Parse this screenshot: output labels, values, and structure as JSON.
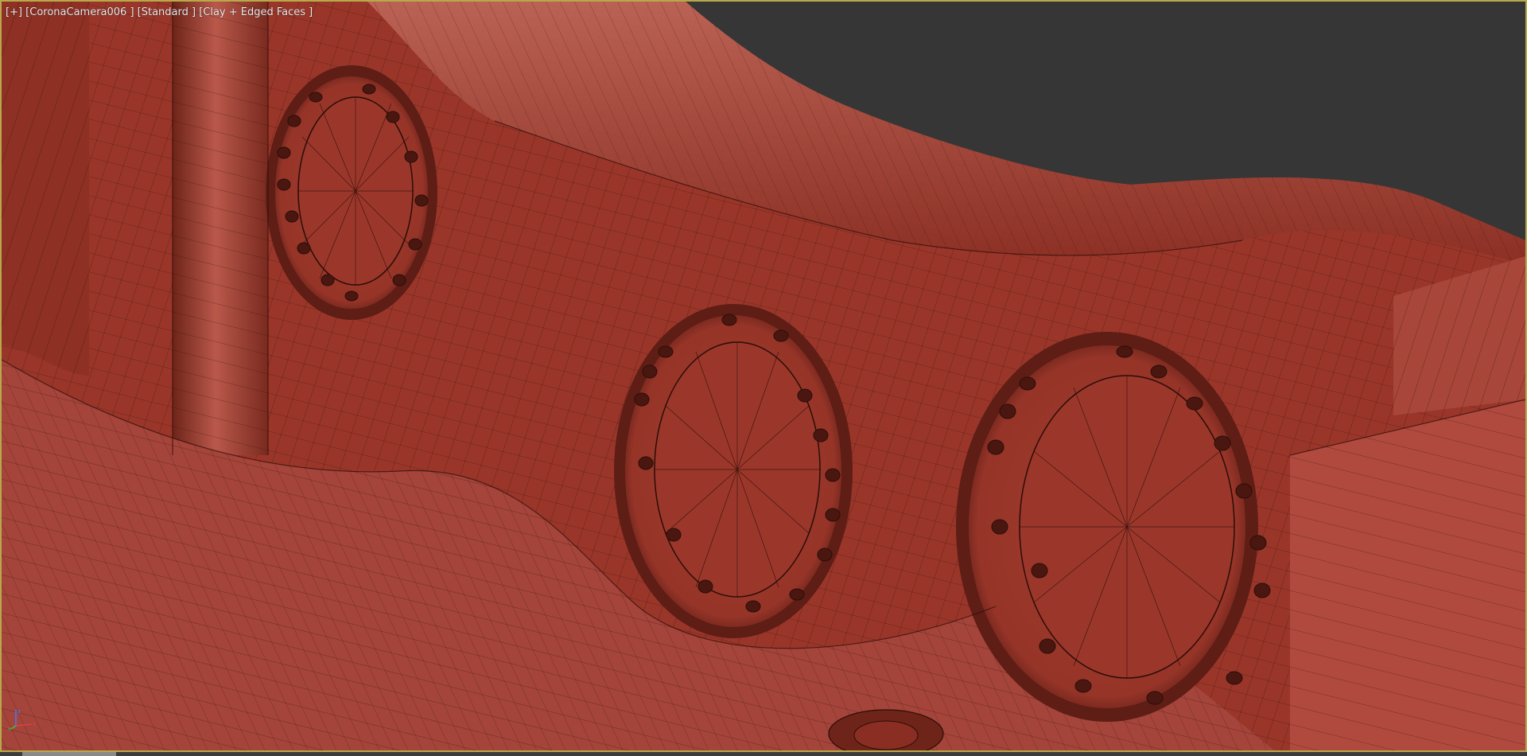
{
  "viewport": {
    "label": "[+] [CoronaCamera006 ] [Standard ] [Clay + Edged Faces ]",
    "background_color": "#363636",
    "border_color": "#b9a84a",
    "clay_color": "#9e3a2e",
    "wire_color": "#2a0d08"
  },
  "axis_gizmo": {
    "x_label": "x",
    "y_label": "y",
    "z_label": "z",
    "icon": "axis-tripod-icon"
  }
}
